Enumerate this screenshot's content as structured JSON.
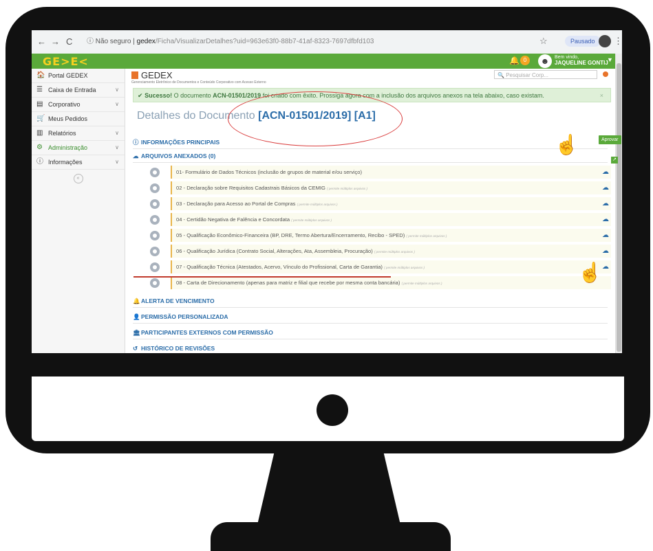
{
  "browser": {
    "back": "←",
    "forward": "→",
    "reload": "C",
    "info_icon": "ⓘ",
    "security": "Não seguro",
    "separator": "|",
    "host": "gedex",
    "path": "/Ficha/VisualizarDetalhes?uid=963e63f0-88b7-41af-8323-7697dfbfd103",
    "paused": "Pausado",
    "kebab": "⋮"
  },
  "header": {
    "logo": "GE>E<",
    "notification_count": "0",
    "welcome": "Bem vindo,",
    "user_name": "JAQUELINE GONTIJ"
  },
  "sidebar": {
    "items": [
      {
        "label": "Portal GEDEX",
        "icon": "🏠"
      },
      {
        "label": "Caixa de Entrada",
        "icon": "☰"
      },
      {
        "label": "Corporativo",
        "icon": "▤"
      },
      {
        "label": "Meus Pedidos",
        "icon": "🛒"
      },
      {
        "label": "Relatórios",
        "icon": "▥"
      },
      {
        "label": "Administração",
        "icon": "⚙"
      },
      {
        "label": "Informações",
        "icon": "ⓘ"
      }
    ],
    "collapse": "«"
  },
  "app": {
    "title": "GEDEX",
    "subtitle": "Gerenciamento Eletrônico de Documentos e Conteúdo Corporativo com Acesso Externo",
    "search_placeholder": "Pesquisar Corp..."
  },
  "alert": {
    "strong": "Sucesso!",
    "text_a": " O documento ",
    "doc": "ACN-01501/2019",
    "text_b": " foi criado com êxito. Prossiga agora com a inclusão dos arquivos anexos na tela abaixo, caso existam.",
    "close": "×"
  },
  "document": {
    "title_prefix": "Detalhes do Documento ",
    "code": "[ACN-01501/2019] [A1]",
    "aprovar": "Aprovar"
  },
  "sections": {
    "main_info": "INFORMAÇÕES PRINCIPAIS",
    "files": "ARQUIVOS ANEXADOS (0)",
    "alert_due": "ALERTA DE VENCIMENTO",
    "custom_perm": "PERMISSÃO PERSONALIZADA",
    "external": "PARTICIPANTES EXTERNOS COM PERMISSÃO",
    "history": "HISTÓRICO DE REVISÕES"
  },
  "files": [
    {
      "label": "01- Formulário de Dados Técnicos (inclusão de grupos de material e/ou serviço)",
      "hint": ""
    },
    {
      "label": "02 - Declaração sobre Requisitos Cadastrais Básicos da CEMIG",
      "hint": "( permite múltiplos arquivos )"
    },
    {
      "label": "03 - Declaração para Acesso ao Portal de Compras",
      "hint": "( permite múltiplos arquivos )"
    },
    {
      "label": "04 - Certidão Negativa de Falência e Concordata",
      "hint": "( permite múltiplos arquivos )"
    },
    {
      "label": "05 - Qualificação Econômico-Financeira (BP, DRE, Termo Abertura/Encerramento, Recibo - SPED)",
      "hint": "( permite múltiplos arquivos )"
    },
    {
      "label": "06 - Qualificação Jurídica (Contrato Social, Alterações, Ata, Assembleia, Procuração)",
      "hint": "( permite múltiplos arquivos )"
    },
    {
      "label": "07 - Qualificação Técnica (Atestados, Acervo, Vínculo do Profissional, Carta de Garantia)",
      "hint": "( permite múltiplos arquivos )"
    },
    {
      "label": "08 - Carta de Direcionamento (apenas para matriz e filial que recebe por mesma conta bancária)",
      "hint": "( permite múltiplos arquivos )"
    }
  ],
  "icons": {
    "bell": "bell-icon",
    "cloud": "cloud-upload-icon",
    "hand": "pointing-hand-icon"
  }
}
